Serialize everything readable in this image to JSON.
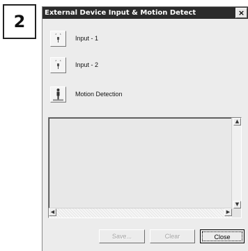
{
  "step_badge": "2",
  "window": {
    "title": "External Device Input & Motion Detect",
    "close_glyph": "×"
  },
  "devices": [
    {
      "label": "Input - 1",
      "icon": "sensor-icon"
    },
    {
      "label": "Input - 2",
      "icon": "sensor-icon"
    },
    {
      "label": "Motion Detection",
      "icon": "person-icon"
    }
  ],
  "scroll": {
    "up": "▲",
    "down": "▼",
    "left": "◀",
    "right": "▶"
  },
  "buttons": {
    "save": "Save...",
    "clear": "Clear",
    "close": "Close"
  }
}
